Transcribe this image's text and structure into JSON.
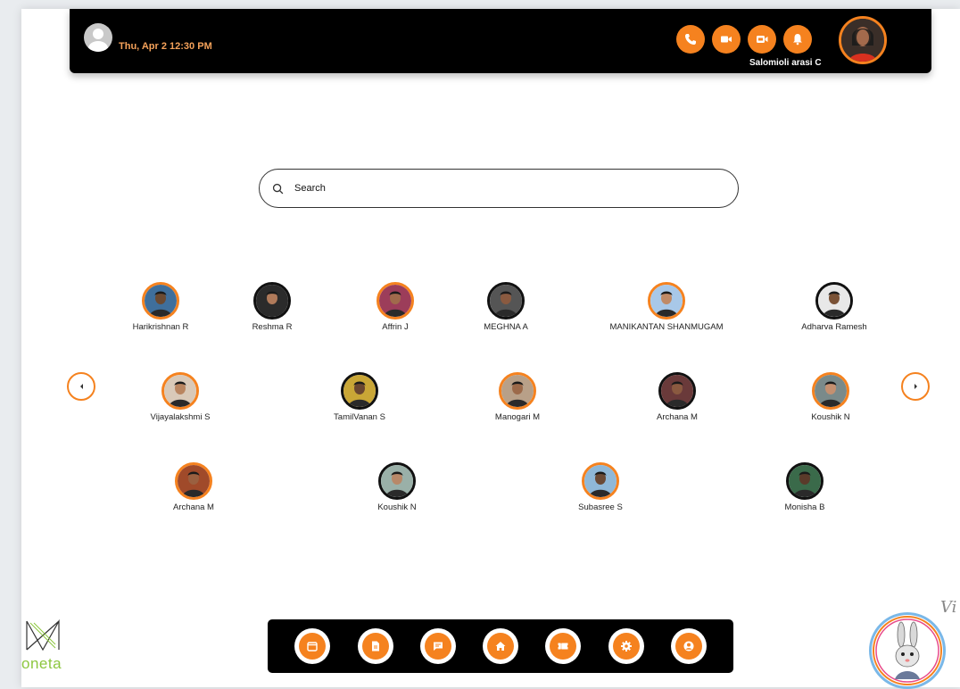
{
  "header": {
    "datetime": "Thu, Apr 2 12:30 PM",
    "user_name": "Salomioli arasi C",
    "icons": [
      "phone-icon",
      "video-icon",
      "video-call-icon",
      "bell-icon"
    ]
  },
  "search": {
    "placeholder": "Search"
  },
  "contacts": [
    {
      "name": "Harikrishnan R",
      "ring": "orange",
      "skin": "#6b4a32",
      "bg": "#3f6f9c"
    },
    {
      "name": "Reshma R",
      "ring": "black",
      "skin": "#b07a5a",
      "bg": "#2b2b2b"
    },
    {
      "name": "Affrin J",
      "ring": "orange",
      "skin": "#a06a4c",
      "bg": "#9c3d5a"
    },
    {
      "name": "MEGHNA A",
      "ring": "black",
      "skin": "#8a5a40",
      "bg": "#555555"
    },
    {
      "name": "MANIKANTAN SHANMUGAM",
      "ring": "orange",
      "skin": "#c08a66",
      "bg": "#a8c8e8"
    },
    {
      "name": "Adharva Ramesh",
      "ring": "black",
      "skin": "#7a5236",
      "bg": "#e8e8e8"
    },
    {
      "name": "Vijayalakshmi S",
      "ring": "orange",
      "skin": "#b98560",
      "bg": "#d9c9b8"
    },
    {
      "name": "TamilVanan S",
      "ring": "black",
      "skin": "#6a4630",
      "bg": "#c9a636"
    },
    {
      "name": "Manogari M",
      "ring": "orange",
      "skin": "#9c6a4a",
      "bg": "#b8a088"
    },
    {
      "name": "Archana M",
      "ring": "black",
      "skin": "#8a5a40",
      "bg": "#6a3a3a"
    },
    {
      "name": "Koushik N",
      "ring": "orange",
      "skin": "#c49070",
      "bg": "#7a8a8a"
    },
    {
      "name": "Archana M",
      "ring": "orange",
      "skin": "#9a6040",
      "bg": "#a04a2a"
    },
    {
      "name": "Koushik N",
      "ring": "black",
      "skin": "#b88868",
      "bg": "#9ab0a8"
    },
    {
      "name": "Subasree S",
      "ring": "orange",
      "skin": "#6a4a36",
      "bg": "#8fb8d8"
    },
    {
      "name": "Monisha B",
      "ring": "black",
      "skin": "#5a3a2a",
      "bg": "#3a6a4a"
    }
  ],
  "bottom_nav": [
    "calendar-icon",
    "document-icon",
    "chat-icon",
    "home-icon",
    "ticket-icon",
    "settings-icon",
    "profile-icon"
  ],
  "brand": {
    "logo_text": "oneta",
    "signature": "Vi"
  },
  "colors": {
    "accent": "#f5821f",
    "bar": "#000000",
    "datetime": "#f5a25a"
  }
}
